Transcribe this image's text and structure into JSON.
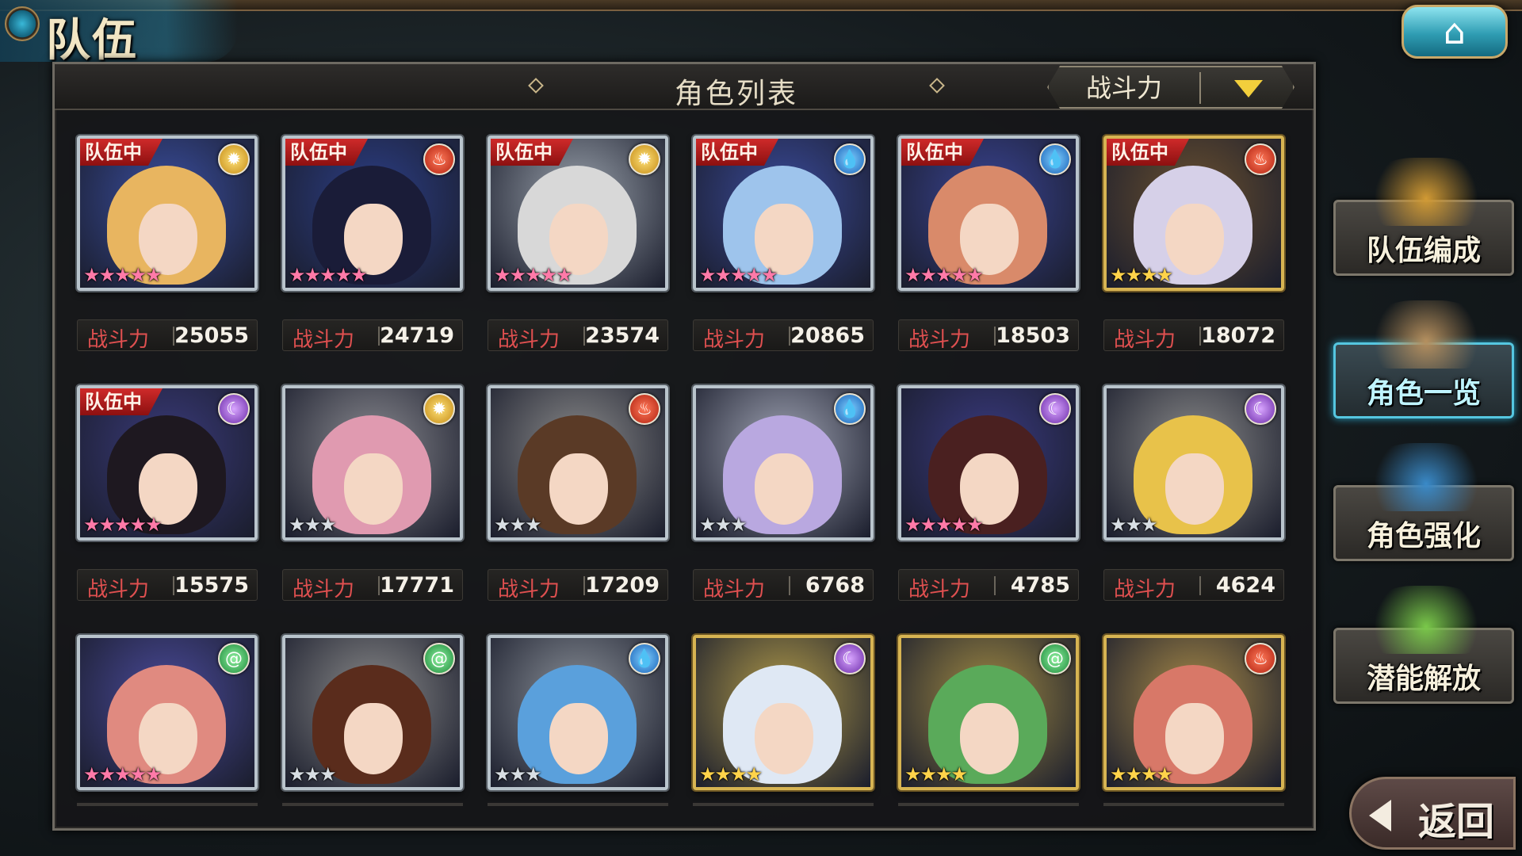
{
  "header": {
    "title": "队伍",
    "home_icon": "⌂"
  },
  "panel": {
    "list_title": "角色列表",
    "sort_label": "战斗力"
  },
  "power_label": "战斗力",
  "party_badge": "队伍中",
  "element_icons": {
    "light": "✹",
    "fire": "♨",
    "water": "💧",
    "dark": "☾",
    "wind": "@"
  },
  "colors": {
    "element_light": "#f3c233",
    "element_fire": "#d8361e",
    "element_water": "#2a86de",
    "element_dark": "#9a4ad8",
    "element_wind": "#2cb24a",
    "badge_red": "#c21f1f",
    "power_label_red": "#e05050",
    "sort_arrow_yellow": "#f2cf3c"
  },
  "characters": [
    {
      "power": "25055",
      "in_party": true,
      "element": "light",
      "rarity": 5,
      "frame": "silver",
      "hair": "#e8b560",
      "bg": "#3a4ea0"
    },
    {
      "power": "24719",
      "in_party": true,
      "element": "fire",
      "rarity": 5,
      "frame": "silver",
      "hair": "#1a1c38",
      "bg": "#2c3e86"
    },
    {
      "power": "23574",
      "in_party": true,
      "element": "light",
      "rarity": 5,
      "frame": "silver",
      "hair": "#d8d8d8",
      "bg": "#9aa2ac"
    },
    {
      "power": "20865",
      "in_party": true,
      "element": "water",
      "rarity": 5,
      "frame": "silver",
      "hair": "#9ec4ec",
      "bg": "#3a4a9a"
    },
    {
      "power": "18503",
      "in_party": true,
      "element": "water",
      "rarity": 5,
      "frame": "silver",
      "hair": "#d98a6a",
      "bg": "#3a4494"
    },
    {
      "power": "18072",
      "in_party": true,
      "element": "fire",
      "rarity": 4,
      "frame": "gold",
      "hair": "#d6d0e8",
      "bg": "#6a5030"
    },
    {
      "power": "15575",
      "in_party": true,
      "element": "dark",
      "rarity": 5,
      "frame": "silver",
      "hair": "#1e1820",
      "bg": "#3a3a7a"
    },
    {
      "power": "17771",
      "in_party": false,
      "element": "light",
      "rarity": 3,
      "frame": "silver",
      "hair": "#e09ab0",
      "bg": "#8a8a90"
    },
    {
      "power": "17209",
      "in_party": false,
      "element": "fire",
      "rarity": 3,
      "frame": "silver",
      "hair": "#5a3a26",
      "bg": "#8a8a8a"
    },
    {
      "power": "6768",
      "in_party": false,
      "element": "water",
      "rarity": 3,
      "frame": "silver",
      "hair": "#b9a8e0",
      "bg": "#a0a4b4"
    },
    {
      "power": "4785",
      "in_party": false,
      "element": "dark",
      "rarity": 5,
      "frame": "silver",
      "hair": "#4a2020",
      "bg": "#3a3a80"
    },
    {
      "power": "4624",
      "in_party": false,
      "element": "dark",
      "rarity": 3,
      "frame": "silver",
      "hair": "#e8c24a",
      "bg": "#8a8a8a"
    },
    {
      "power": "",
      "in_party": false,
      "element": "wind",
      "rarity": 5,
      "frame": "silver",
      "hair": "#e08a80",
      "bg": "#4a4a9a"
    },
    {
      "power": "",
      "in_party": false,
      "element": "wind",
      "rarity": 3,
      "frame": "silver",
      "hair": "#5a2c1c",
      "bg": "#8a8a8a"
    },
    {
      "power": "",
      "in_party": false,
      "element": "water",
      "rarity": 3,
      "frame": "silver",
      "hair": "#5aa0dc",
      "bg": "#8a9098"
    },
    {
      "power": "",
      "in_party": false,
      "element": "dark",
      "rarity": 4,
      "frame": "gold",
      "hair": "#dfe8f4",
      "bg": "#b09a4a"
    },
    {
      "power": "",
      "in_party": false,
      "element": "wind",
      "rarity": 4,
      "frame": "gold",
      "hair": "#5aaa5a",
      "bg": "#a08a44"
    },
    {
      "power": "",
      "in_party": false,
      "element": "fire",
      "rarity": 4,
      "frame": "gold",
      "hair": "#d87868",
      "bg": "#a88a48"
    }
  ],
  "side_menu": [
    {
      "label": "队伍编成",
      "icon": "party-members-icon",
      "active": false,
      "art": "#d19a34"
    },
    {
      "label": "角色一览",
      "icon": "book-icon",
      "active": true,
      "art": "#b58f5e"
    },
    {
      "label": "角色强化",
      "icon": "crystal-upgrade-icon",
      "active": false,
      "art": "#3a8ac8"
    },
    {
      "label": "潜能解放",
      "icon": "potential-orb-icon",
      "active": false,
      "art": "#7ac84a"
    }
  ],
  "back_label": "返回"
}
